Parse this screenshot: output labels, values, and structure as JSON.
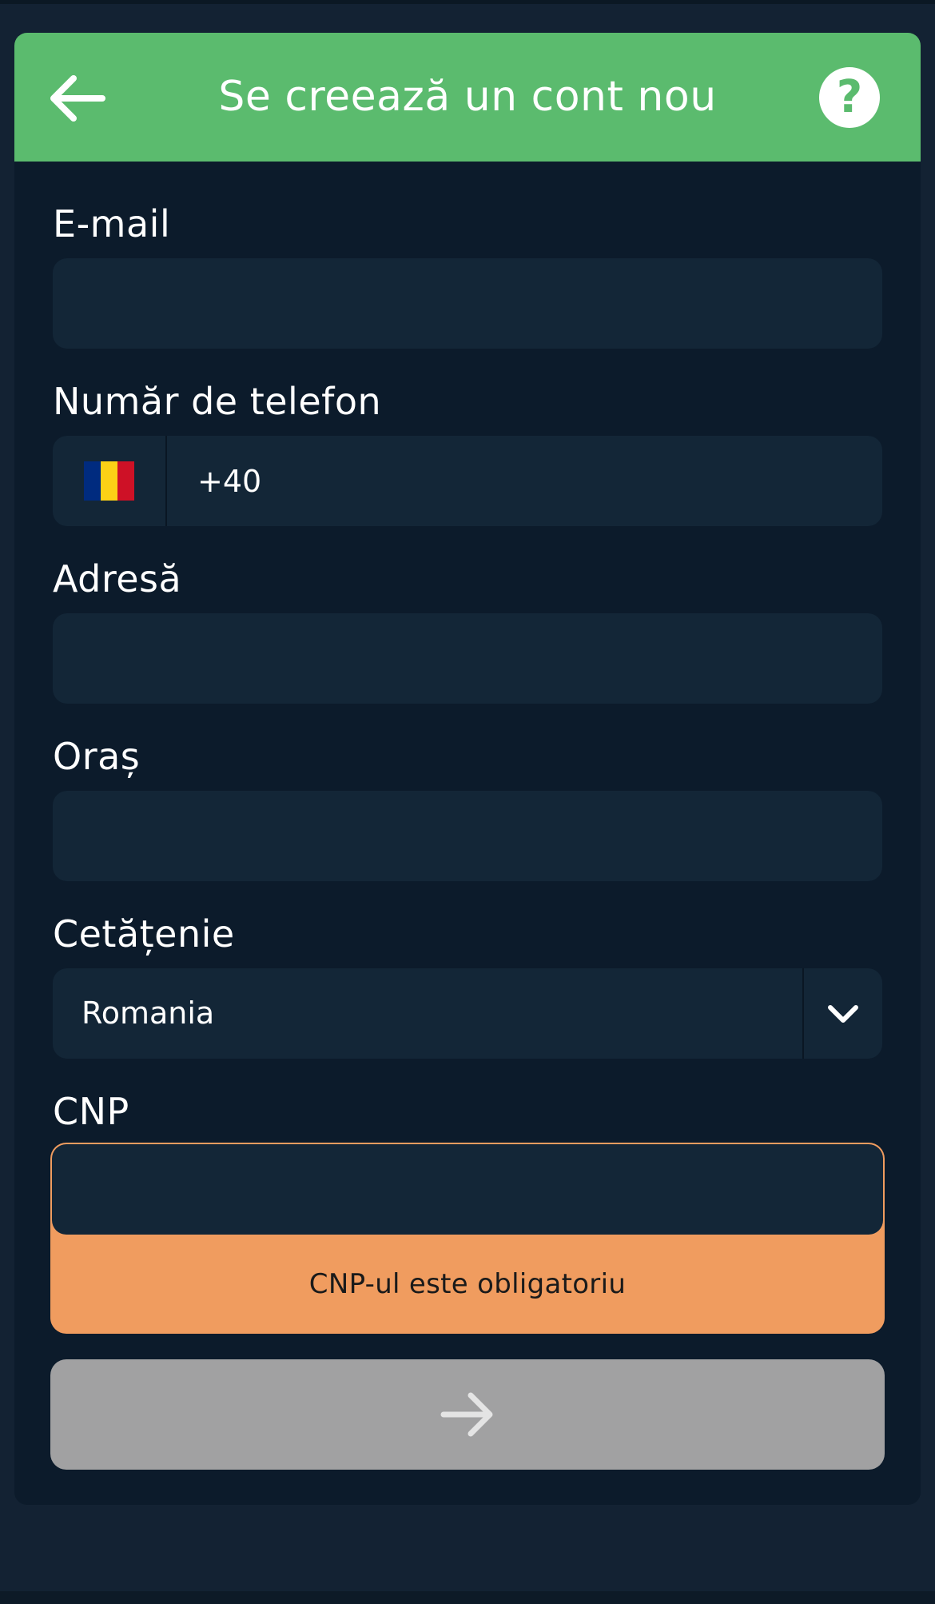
{
  "header": {
    "title": "Se creează un cont nou",
    "back_icon": "arrow-left-icon",
    "help_icon": "question-circle-icon",
    "help_glyph": "?",
    "background_color": "#5bbb6e"
  },
  "form": {
    "email": {
      "label": "E-mail",
      "value": ""
    },
    "phone": {
      "label": "Număr de telefon",
      "country_flag": "romania-flag-icon",
      "flag_colors": [
        "#002b7f",
        "#fcd116",
        "#ce1126"
      ],
      "value": "+40"
    },
    "address": {
      "label": "Adresă",
      "value": ""
    },
    "city": {
      "label": "Oraș",
      "value": ""
    },
    "citizenship": {
      "label": "Cetățenie",
      "selected": "Romania",
      "dropdown_icon": "chevron-down-icon"
    },
    "cnp": {
      "label": "CNP",
      "value": "",
      "error": "CNP-ul este obligatoriu",
      "error_color": "#f09c5f"
    }
  },
  "next_button": {
    "icon": "arrow-right-icon",
    "state": "disabled",
    "color": "#a1a1a2"
  }
}
